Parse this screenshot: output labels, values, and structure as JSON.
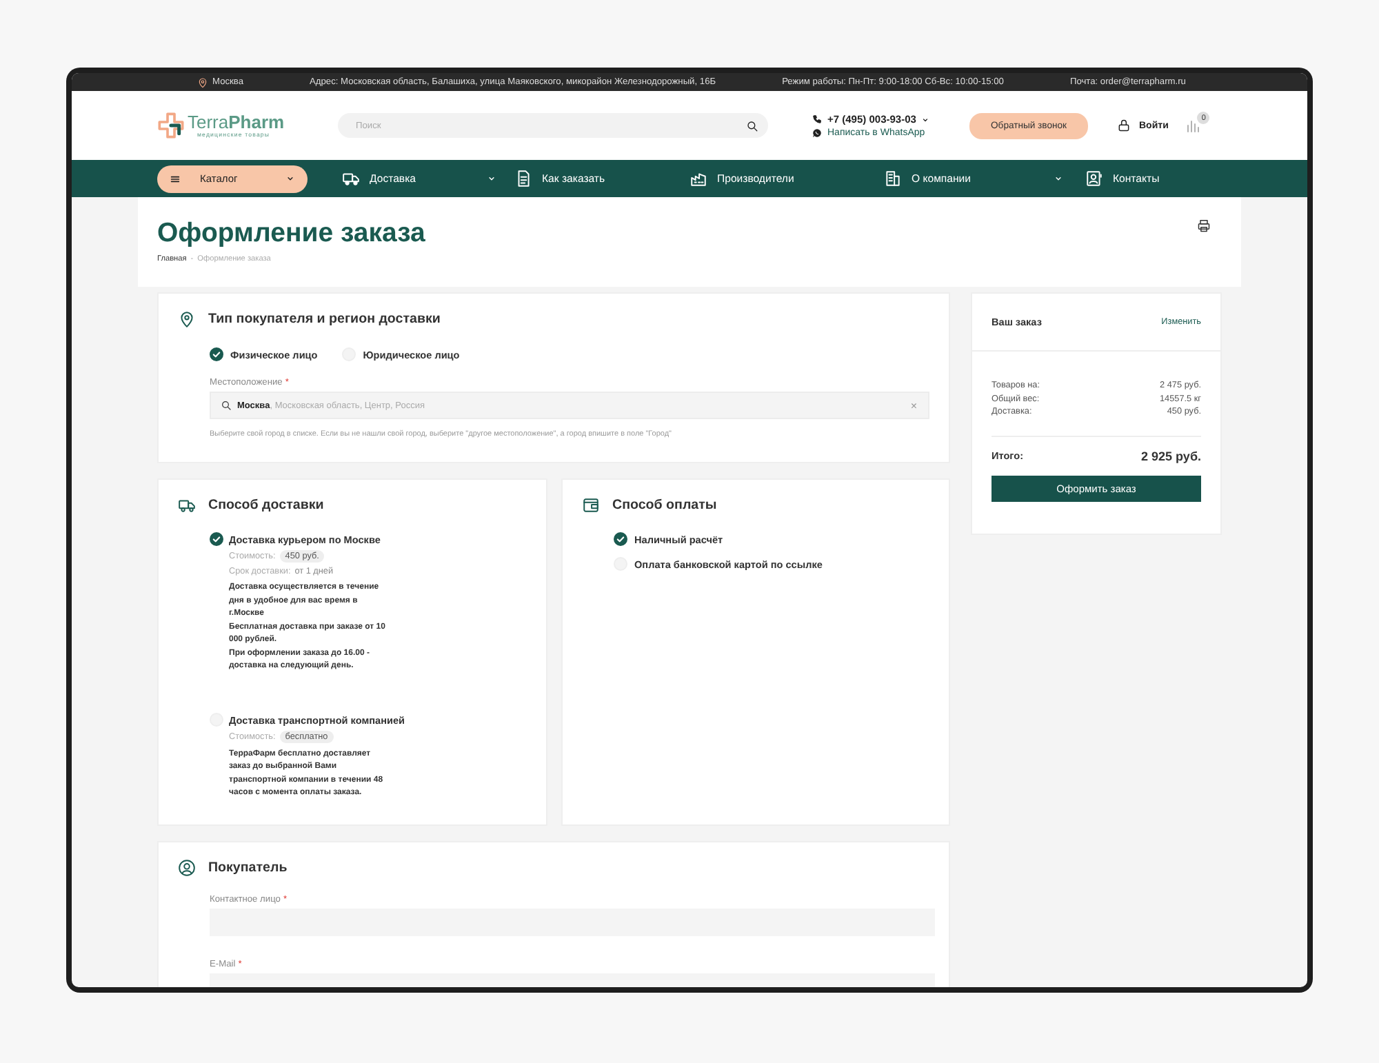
{
  "top_bar": {
    "city": "Москва",
    "address": "Адрес: Московская область, Балашиха, улица Маяковского, микорайон Железнодорожный, 16Б",
    "hours": "Режим работы: Пн-Пт: 9:00-18:00 Сб-Вс: 10:00-15:00",
    "email": "Почта: order@terrapharm.ru"
  },
  "header": {
    "logo": {
      "name": "Terra**Pharm**",
      "tagline": "медицинские товары"
    },
    "search": {
      "placeholder": "Поиск"
    },
    "phone": "+7 (495) 003-93-03",
    "whatsapp": "Написать в WhatsApp",
    "callback_button": "Обратный звонок",
    "login": "Войти",
    "compare_count": "0"
  },
  "nav": [
    {
      "label": "Каталог",
      "kind": "catalog"
    },
    {
      "label": "Доставка",
      "kind": "delivery",
      "dropdown": true
    },
    {
      "label": "Как заказать",
      "kind": "howto",
      "dropdown": false
    },
    {
      "label": "Производители",
      "kind": "makers",
      "dropdown": false
    },
    {
      "label": "О компании",
      "kind": "company",
      "dropdown": true
    },
    {
      "label": "Контакты",
      "kind": "contacts",
      "dropdown": false
    }
  ],
  "page": {
    "title": "Оформление заказа",
    "breadcrumbs": [
      "Главная",
      "Оформление заказа"
    ],
    "separator": "-"
  },
  "buyer_type": {
    "title": "Тип покупателя и регион доставки",
    "options": [
      {
        "label": "Физическое лицо",
        "selected": true
      },
      {
        "label": "Юридическое лицо",
        "selected": false
      }
    ],
    "location": {
      "label": "Местоположение",
      "required_mark": "*",
      "city": "Москва",
      "region": ", Московская область, Центр, Россия",
      "clear": "×"
    },
    "hint": "Выберите свой город в списке. Если вы не нашли свой город, выберите \"другое местоположение\", а город впишите в поле \"Город\""
  },
  "delivery": {
    "title": "Способ доставки",
    "options": [
      {
        "name": "Доставка курьером по Москве",
        "selected": true,
        "cost_label": "Стоимость:",
        "cost": "450 руб.",
        "term_label": "Срок доставки:",
        "term": "от 1 дней",
        "description": [
          "Доставка осуществляется в течение дня в удобное для вас время в г.Москве",
          "Бесплатная доставка при заказе от 10 000 рублей.",
          "При оформлении заказа до 16.00 - доставка на следующий день."
        ]
      },
      {
        "name": "Доставка транспортной компанией",
        "selected": false,
        "cost_label": "Стоимость:",
        "cost": "бесплатно",
        "description": [
          "ТерраФарм бесплатно доставляет заказ до выбранной Вами транспортной компании в течении 48 часов с момента оплаты заказа."
        ]
      }
    ]
  },
  "payment": {
    "title": "Способ оплаты",
    "options": [
      {
        "label": "Наличный расчёт",
        "selected": true
      },
      {
        "label": "Оплата банковской картой по ссылке",
        "selected": false
      }
    ]
  },
  "buyer": {
    "title": "Покупатель",
    "fields": [
      {
        "label": "Контактное лицо",
        "required_mark": "*"
      },
      {
        "label": "E-Mail",
        "required_mark": "*"
      }
    ]
  },
  "summary": {
    "title": "Ваш заказ",
    "edit_link": "Изменить",
    "rows": [
      {
        "label": "Товаров на:",
        "value": "2 475 руб."
      },
      {
        "label": "Общий вес:",
        "value": "14557.5 кг"
      },
      {
        "label": "Доставка:",
        "value": "450 руб."
      }
    ],
    "total_label": "Итого:",
    "total": "2 925 руб.",
    "submit_button": "Оформить заказ"
  }
}
